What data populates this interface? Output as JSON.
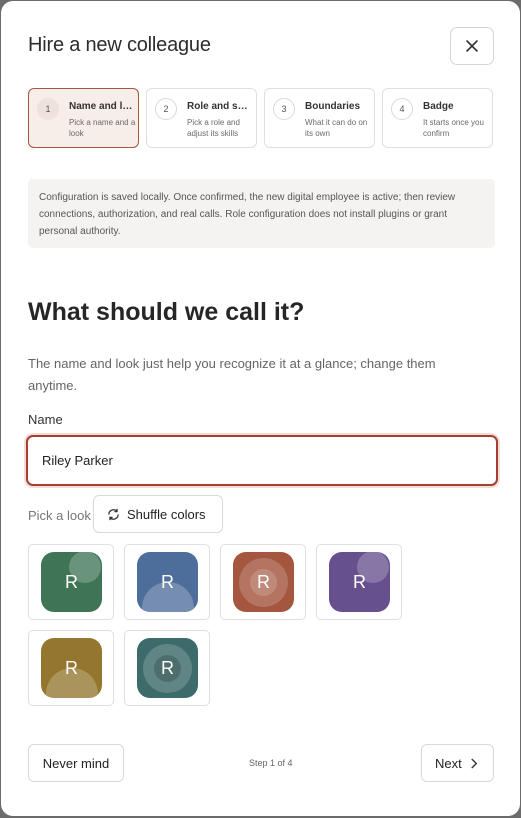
{
  "dialog": {
    "title": "Hire a new colleague",
    "close_icon": "close-icon"
  },
  "steps": [
    {
      "number": "1",
      "title": "Name and look",
      "description": "Pick a name and a look",
      "active": true
    },
    {
      "number": "2",
      "title": "Role and skills",
      "description": "Pick a role and adjust its skills",
      "active": false
    },
    {
      "number": "3",
      "title": "Boundaries",
      "description": "What it can do on its own",
      "active": false
    },
    {
      "number": "4",
      "title": "Badge",
      "description": "It starts once you confirm",
      "active": false
    }
  ],
  "info": {
    "text": "Configuration is saved locally. Once confirmed, the new digital employee is active; then review connections, authorization, and real calls. Role configuration does not install plugins or grant personal authority."
  },
  "main": {
    "heading": "What should we call it?",
    "subtext": "The name and look just help you recognize it at a glance; change them anytime."
  },
  "name_field": {
    "label": "Name",
    "value": "Riley Parker",
    "placeholder": ""
  },
  "look": {
    "label": "Pick a look",
    "shuffle_label": "Shuffle colors",
    "shuffle_icon": "refresh-icon",
    "options": [
      {
        "letter": "R",
        "color": "#3f7556",
        "selected": false
      },
      {
        "letter": "R",
        "color": "#4d6d9b",
        "selected": false
      },
      {
        "letter": "R",
        "color": "#a4563f",
        "selected": false
      },
      {
        "letter": "R",
        "color": "#66508e",
        "selected": false
      },
      {
        "letter": "R",
        "color": "#94762e",
        "selected": false
      },
      {
        "letter": "R",
        "color": "#3d6b6b",
        "selected": false
      }
    ]
  },
  "footer": {
    "cancel_label": "Never mind",
    "step_indicator": "Step 1 of 4",
    "next_label": "Next",
    "next_icon": "chevron-right-icon"
  },
  "colors": {
    "accent": "#a4402f",
    "active_step_bg": "#f7ede9"
  }
}
